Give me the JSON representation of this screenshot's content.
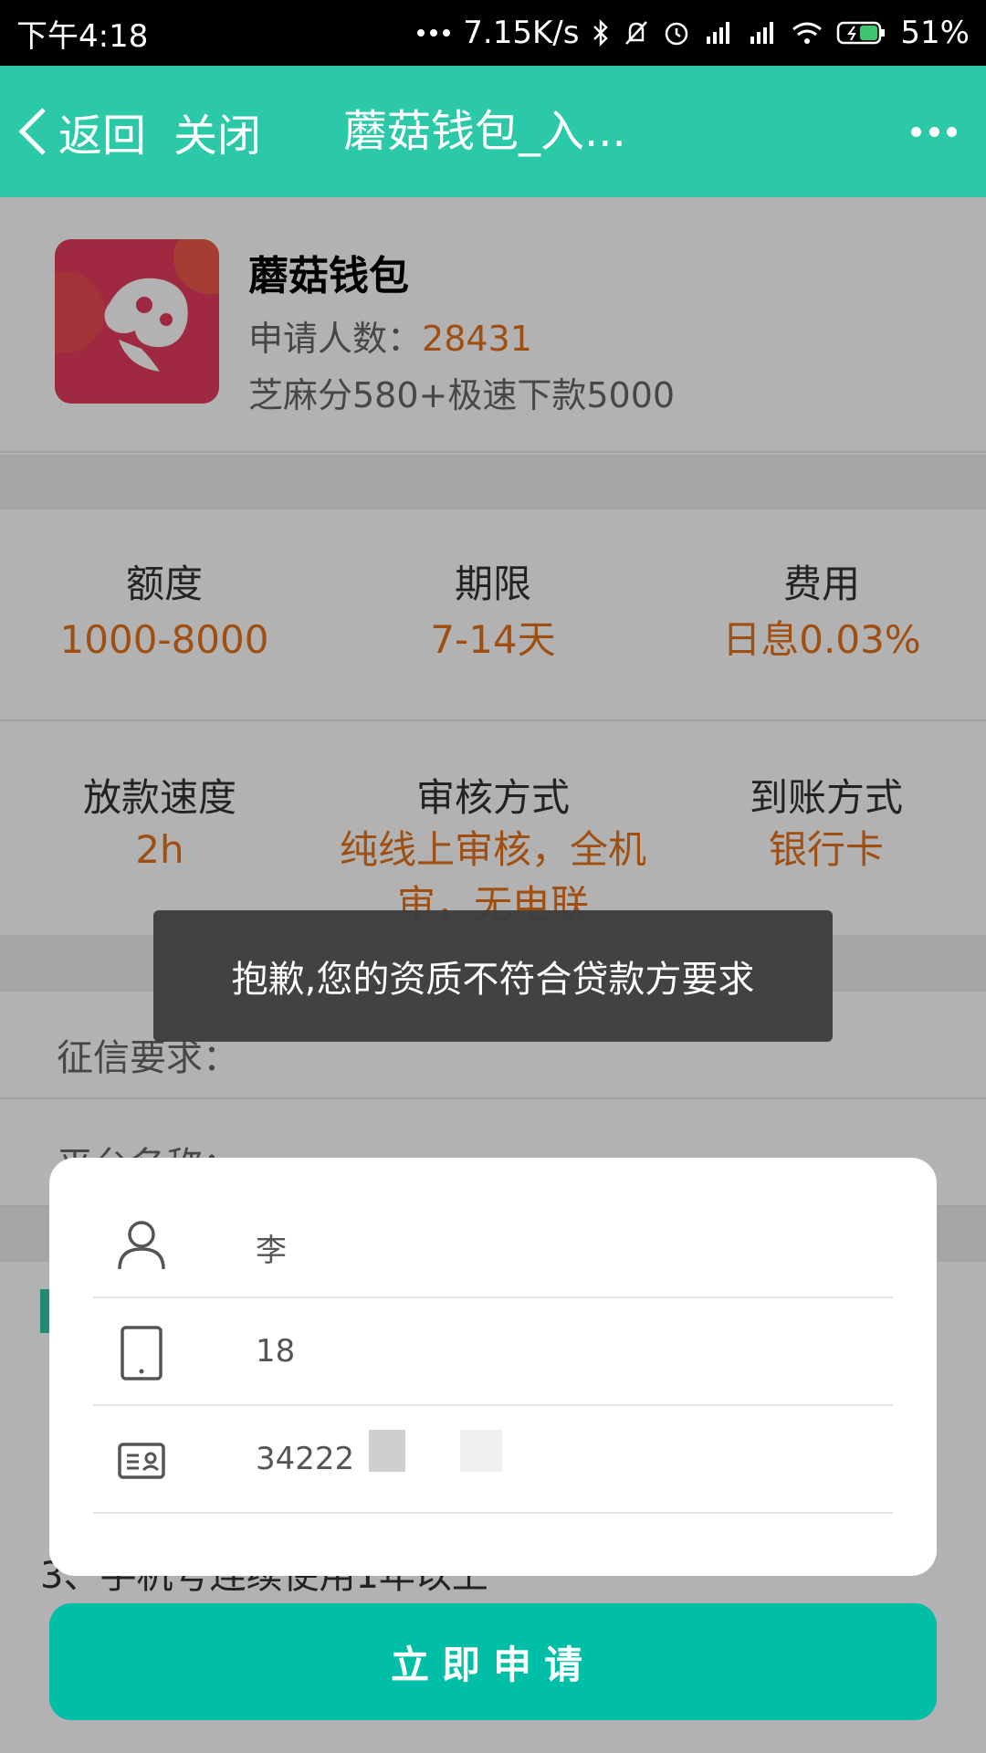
{
  "status_bar": {
    "time": "下午4:18",
    "network_speed": "7.15K/s",
    "battery": "51%",
    "icons": [
      "more-dots-icon",
      "bluetooth-icon",
      "mute-icon",
      "alarm-icon",
      "hd-signal-icon",
      "signal-icon",
      "wifi-icon",
      "battery-icon"
    ]
  },
  "nav": {
    "back_label": "返回",
    "close_label": "关闭",
    "title": "蘑菇钱包_入..."
  },
  "product": {
    "name": "蘑菇钱包",
    "applicants_label": "申请人数：",
    "applicants_count": "28431",
    "description": "芝麻分580+极速下款5000"
  },
  "details": {
    "row1": [
      {
        "label": "额度",
        "value": "1000-8000"
      },
      {
        "label": "期限",
        "value": "7-14天"
      },
      {
        "label": "费用",
        "value": "日息0.03%"
      }
    ],
    "row2": [
      {
        "label": "放款速度",
        "value": "2h"
      },
      {
        "label": "审核方式",
        "value": "纯线上审核，全机审，无电联"
      },
      {
        "label": "到账方式",
        "value": "银行卡"
      }
    ]
  },
  "requirements": {
    "credit_label": "征信要求：",
    "platform_label": "平台名称："
  },
  "background_list": {
    "item3": "3、手机号连续使用1年以上"
  },
  "toast": {
    "message": "抱歉,您的资质不符合贷款方要求"
  },
  "form": {
    "name_value": "李",
    "phone_value": "18",
    "id_value": "34222"
  },
  "apply_button": "立即申请",
  "colors": {
    "nav": "#2cc9a8",
    "accent_orange": "#e5711c",
    "button": "#00bfa6"
  }
}
